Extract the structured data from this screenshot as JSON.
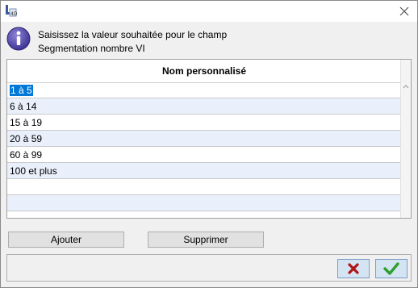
{
  "window": {
    "icons": {
      "app": "app-icon",
      "close": "close-icon"
    }
  },
  "header": {
    "icon": "info-icon",
    "line1": "Saisissez la valeur souhaitée pour le champ",
    "line2": "Segmentation nombre VI"
  },
  "table": {
    "column_header": "Nom personnalisé",
    "rows": [
      "1 à 5",
      "6 à 14",
      "15 à 19",
      "20 à 59",
      "60 à 99",
      "100 et plus",
      "",
      ""
    ],
    "selected_row": 0
  },
  "buttons": {
    "add": "Ajouter",
    "delete": "Supprimer"
  },
  "footer": {
    "cancel_icon": "cancel-x-icon",
    "confirm_icon": "confirm-check-icon"
  },
  "colors": {
    "selection": "#0078d7",
    "alt_row": "#eaf0fb",
    "cancel": "#b01515",
    "confirm": "#2e9e2e"
  }
}
